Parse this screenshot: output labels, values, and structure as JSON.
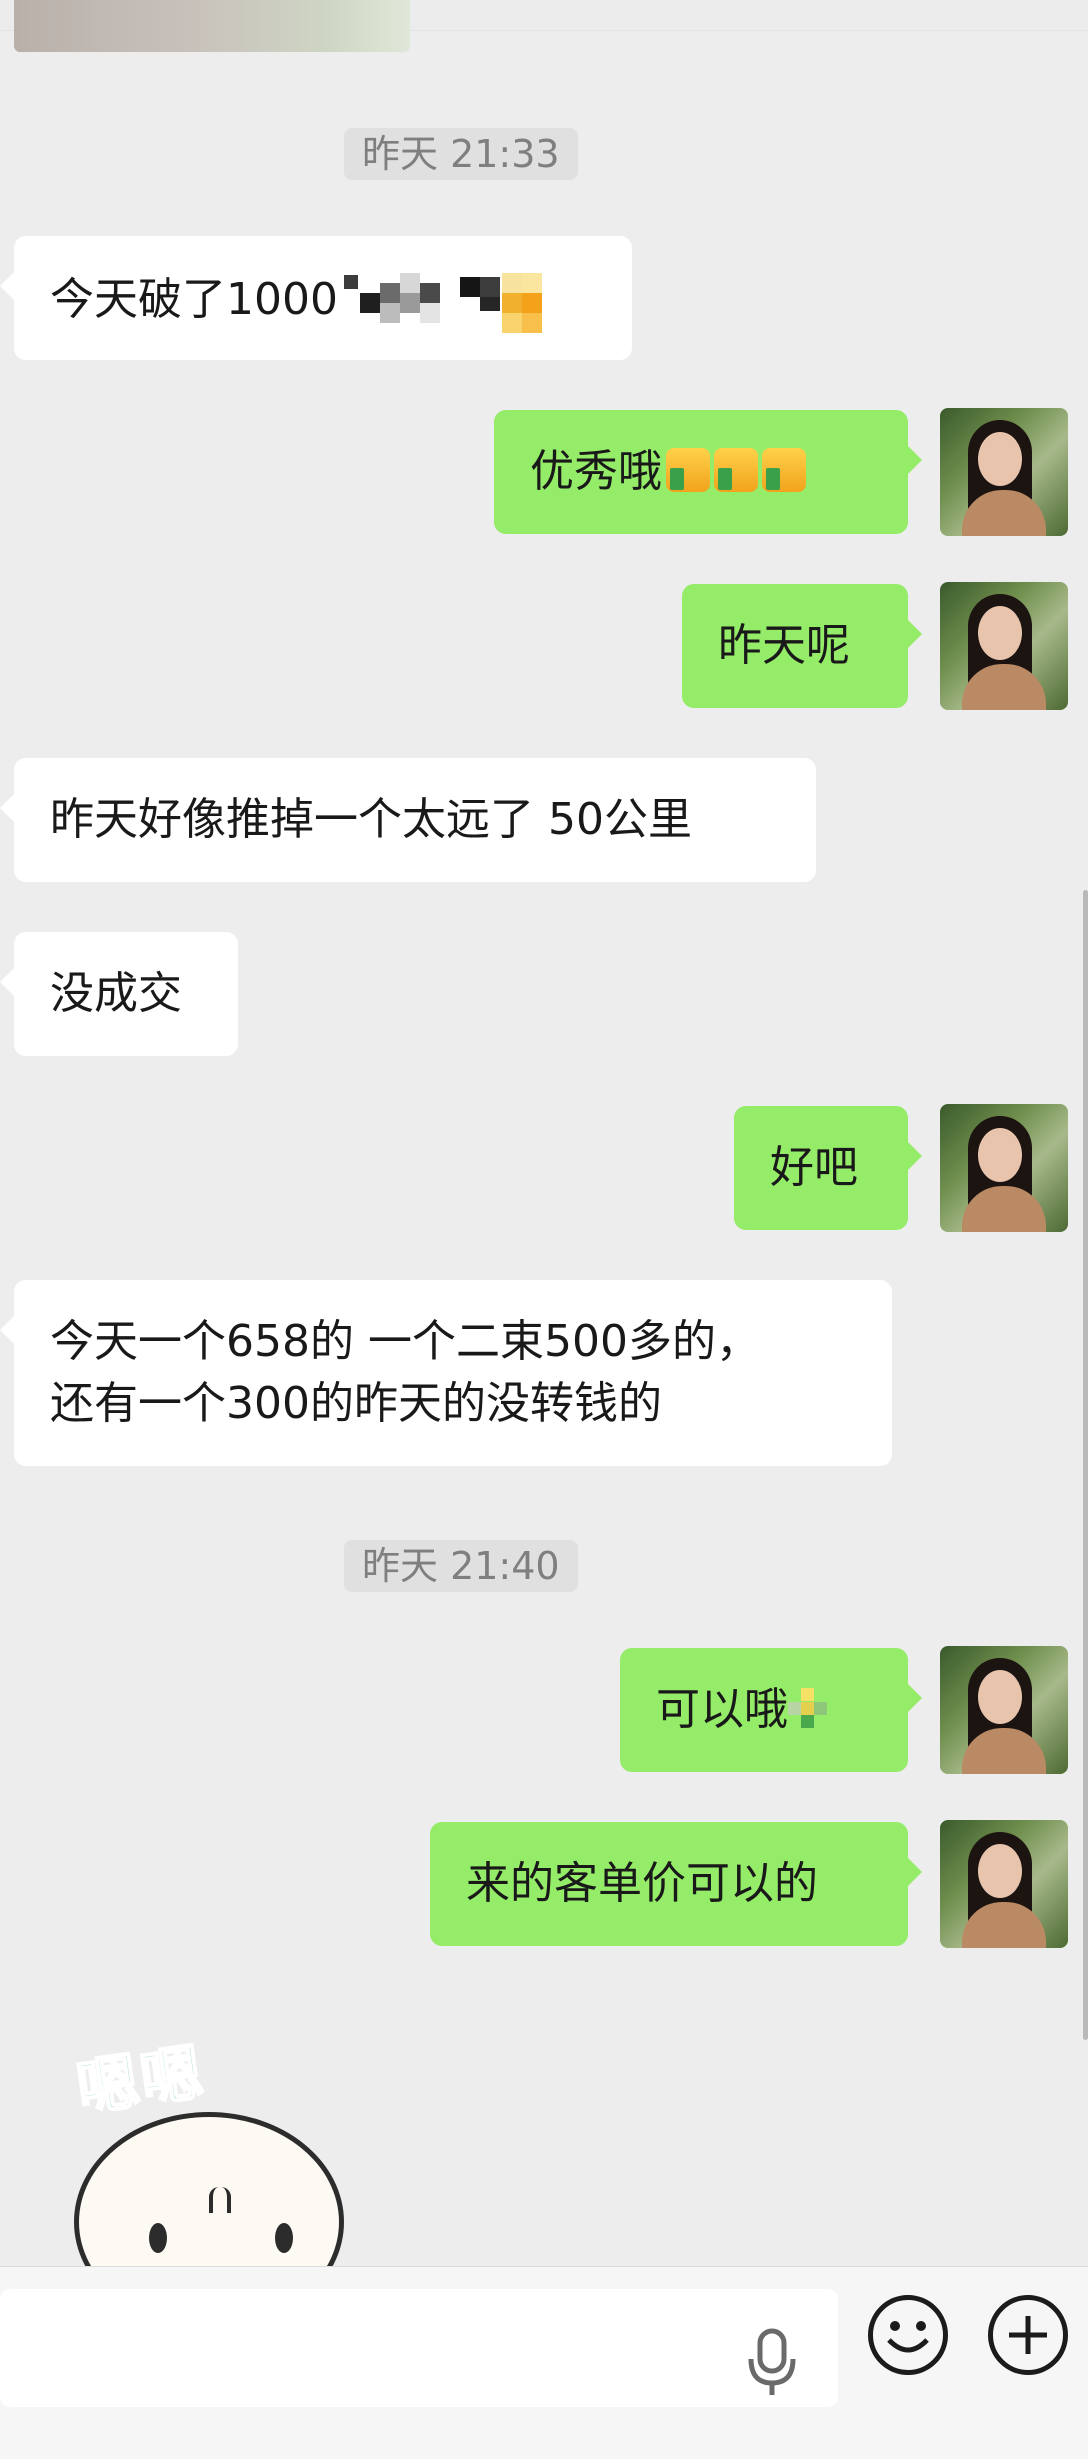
{
  "timestamps": [
    "昨天 21:33",
    "昨天 21:40"
  ],
  "messages": [
    {
      "side": "left",
      "lines": [
        "今天破了1000"
      ],
      "redacted": true
    },
    {
      "side": "right",
      "lines": [
        "优秀哦"
      ],
      "emoji": "thumbs-up",
      "emoji_count": 3
    },
    {
      "side": "right",
      "lines": [
        "昨天呢"
      ]
    },
    {
      "side": "left",
      "lines": [
        "昨天好像推掉一个太远了 50公里"
      ]
    },
    {
      "side": "left",
      "lines": [
        "没成交"
      ]
    },
    {
      "side": "right",
      "lines": [
        "好吧"
      ]
    },
    {
      "side": "left",
      "lines": [
        "今天一个658的 一个二束500多的，",
        "还有一个300的昨天的没转钱的"
      ]
    },
    {
      "side": "right",
      "lines": [
        "可以哦"
      ],
      "redacted": true
    },
    {
      "side": "right",
      "lines": [
        "来的客单价可以的"
      ]
    }
  ],
  "sticker": {
    "text": "嗯嗯",
    "icon": "duck-sticker"
  },
  "input_bar": {
    "placeholder": "",
    "icons": [
      "microphone-icon",
      "emoji-icon",
      "plus-icon"
    ]
  },
  "colors": {
    "background": "#ededed",
    "right_bubble": "#95ec69",
    "left_bubble": "#ffffff",
    "timestamp_text": "#7f7f7f"
  }
}
